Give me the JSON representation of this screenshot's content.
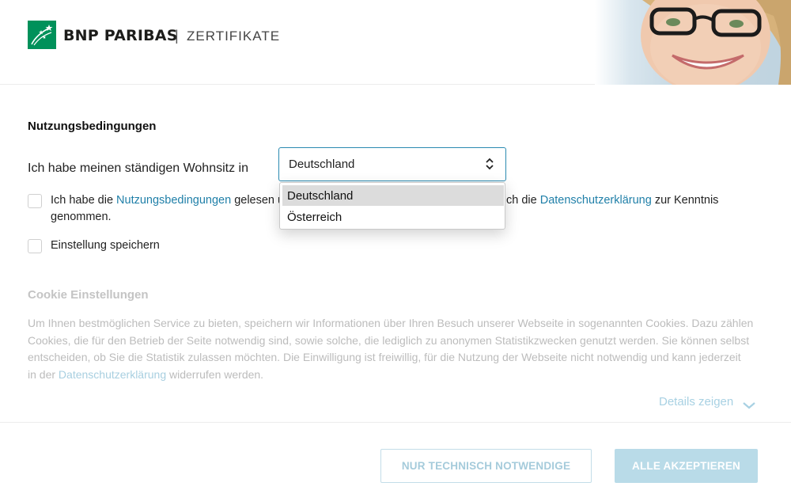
{
  "header": {
    "brand": "BNP PARIBAS",
    "separator": "|",
    "sub_brand": "ZERTIFIKATE",
    "logo_icon": "bnp-stars-logo-icon",
    "brand_color": "#00915a"
  },
  "terms": {
    "title": "Nutzungsbedingungen",
    "residence_label": "Ich habe meinen ständigen Wohnsitz in",
    "residence_select": {
      "value": "Deutschland",
      "icon": "select-updown-icon",
      "options": [
        "Deutschland",
        "Österreich"
      ],
      "highlighted": "Deutschland"
    },
    "accept_checkbox": {
      "prefix": "Ich habe die ",
      "link1": "Nutzungsbedingungen",
      "middle_visible_left": " gelesen ur",
      "middle_visible_right": "ch die ",
      "link2": "Datenschutzerklärung",
      "suffix": " zur Kenntnis",
      "line2": "genommen.",
      "checked": false
    },
    "save_checkbox": {
      "label": "Einstellung speichern",
      "checked": false
    }
  },
  "cookies": {
    "title": "Cookie Einstellungen",
    "line1": "Um Ihnen bestmöglichen Service zu bieten, speichern wir Informationen über Ihren Besuch unserer Webseite in sogenannten Cookies. Dazu zählen",
    "line2": "Cookies, die für den Betrieb der Seite notwendig sind, sowie solche, die lediglich zu anonymen Statistikzwecken genutzt werden. Sie können selbst",
    "line3": "entscheiden, ob Sie die Statistik zulassen möchten. Die Einwilligung ist freiwillig, für die Nutzung der Webseite nicht notwendig und kann jederzeit",
    "line4_prefix": "in der ",
    "line4_link": "Datenschutzerklärung",
    "line4_suffix": " widerrufen werden.",
    "details_label": "Details zeigen",
    "details_icon": "chevron-down-icon"
  },
  "buttons": {
    "necessary_only": "NUR TECHNISCH NOTWENDIGE",
    "accept_all": "ALLE AKZEPTIEREN"
  },
  "colors": {
    "link": "#1f7fa8",
    "select_border": "#2a8ab1",
    "disabled_text": "#bcbcbc",
    "accept_all_bg": "#b9dbe8"
  }
}
